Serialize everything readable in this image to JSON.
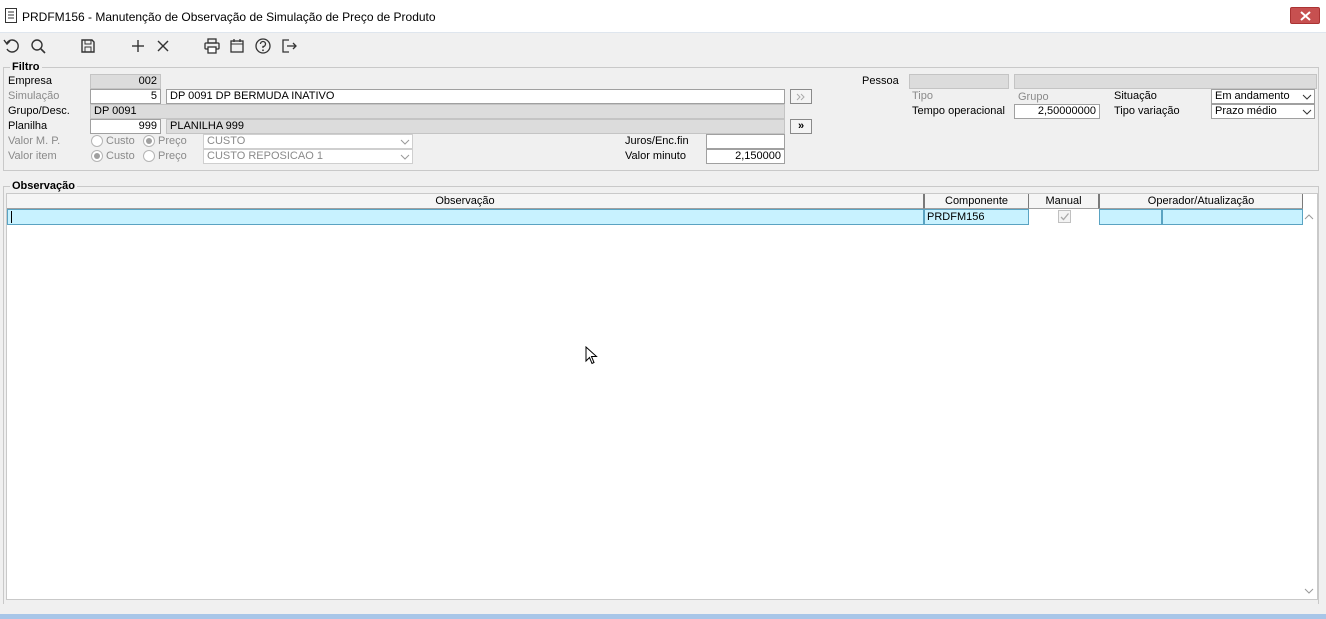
{
  "window": {
    "title": "PRDFM156 - Manutenção de Observação de Simulação de Preço de Produto"
  },
  "toolbar": {
    "icons": [
      "undo-icon",
      "search-icon",
      "save-icon",
      "add-icon",
      "delete-icon",
      "print-icon",
      "calendar-icon",
      "help-icon",
      "exit-icon"
    ]
  },
  "filtro": {
    "label": "Filtro",
    "empresa": {
      "label": "Empresa",
      "value": "002"
    },
    "simulacao": {
      "label": "Simulação",
      "code": "5",
      "desc": "DP 0091 DP BERMUDA INATIVO"
    },
    "grupo": {
      "label": "Grupo/Desc.",
      "value": "DP 0091"
    },
    "planilha": {
      "label": "Planilha",
      "code": "999",
      "desc": "PLANILHA 999",
      "button": "»"
    },
    "valor_mp": {
      "label": "Valor M. P.",
      "opt1": "Custo",
      "opt2": "Preço",
      "select": "CUSTO"
    },
    "valor_item": {
      "label": "Valor item",
      "opt1": "Custo",
      "opt2": "Preço",
      "select": "CUSTO REPOSICAO 1"
    },
    "juros": {
      "label": "Juros/Enc.fin",
      "value": ""
    },
    "valor_minuto": {
      "label": "Valor minuto",
      "value": "2,150000"
    },
    "pessoa": {
      "label": "Pessoa",
      "code": "",
      "desc": ""
    },
    "tipo": {
      "label": "Tipo"
    },
    "grupo2": {
      "label": "Grupo"
    },
    "situacao": {
      "label": "Situação",
      "value": "Em andamento"
    },
    "tempo": {
      "label": "Tempo operacional",
      "value": "2,50000000"
    },
    "tipo_variacao": {
      "label": "Tipo variação",
      "value": "Prazo médio"
    }
  },
  "observacao": {
    "label": "Observação",
    "columns": [
      "Observação",
      "Componente",
      "Manual",
      "Operador/Atualização"
    ],
    "rows": [
      {
        "observacao": "",
        "componente": "PRDFM156",
        "manual": true,
        "operador": "",
        "atualizacao": ""
      }
    ]
  },
  "colors": {
    "accent_selection": "#c8f2ff",
    "close": "#c75050"
  }
}
